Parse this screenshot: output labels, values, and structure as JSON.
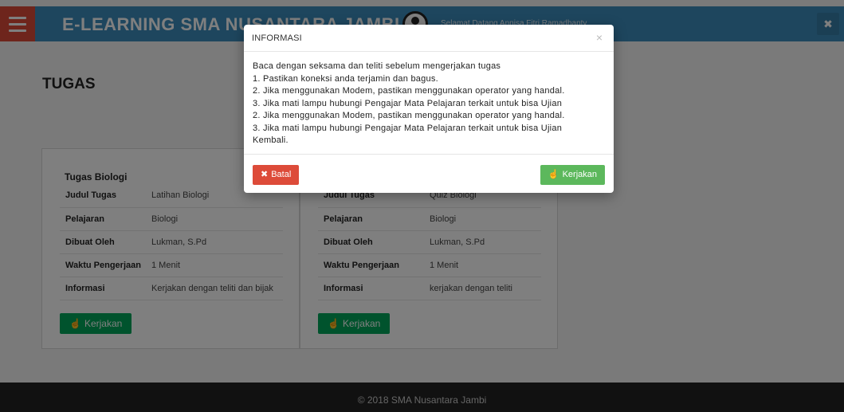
{
  "header": {
    "brand": "E-LEARNING SMA NUSANTARA JAMBI",
    "welcome": "Selamat Datang Annisa Fitri Ramadhanty",
    "corner_icon": "✖"
  },
  "page": {
    "title": "TUGAS"
  },
  "assignments": [
    {
      "heading": "Tugas Biologi",
      "rows": [
        {
          "label": "Judul Tugas",
          "value": "Latihan Biologi"
        },
        {
          "label": "Pelajaran",
          "value": "Biologi"
        },
        {
          "label": "Dibuat Oleh",
          "value": "Lukman, S.Pd"
        },
        {
          "label": "Waktu Pengerjaan",
          "value": "1 Menit"
        },
        {
          "label": "Informasi",
          "value": "Kerjakan dengan teliti dan bijak"
        }
      ],
      "button": "Kerjakan"
    },
    {
      "heading": "",
      "rows": [
        {
          "label": "Judul Tugas",
          "value": "Quiz Biologi"
        },
        {
          "label": "Pelajaran",
          "value": "Biologi"
        },
        {
          "label": "Dibuat Oleh",
          "value": "Lukman, S.Pd"
        },
        {
          "label": "Waktu Pengerjaan",
          "value": "1 Menit"
        },
        {
          "label": "Informasi",
          "value": "kerjakan dengan teliti"
        }
      ],
      "button": "Kerjakan"
    }
  ],
  "footer": {
    "text": "© 2018 SMA Nusantara Jambi"
  },
  "modal": {
    "title": "INFORMASI",
    "close": "×",
    "lines": [
      "Baca dengan seksama dan teliti sebelum mengerjakan tugas",
      "1. Pastikan koneksi anda terjamin dan bagus.",
      "2. Jika menggunakan Modem, pastikan menggunakan operator yang handal.",
      "3. Jika mati lampu hubungi Pengajar Mata Pelajaran terkait untuk bisa Ujian",
      "2. Jika menggunakan Modem, pastikan menggunakan operator yang handal.",
      "3. Jika mati lampu hubungi Pengajar Mata Pelajaran terkait untuk bisa Ujian",
      "Kembali."
    ],
    "cancel_label": "Batal",
    "cancel_icon": "✖",
    "go_label": "Kerjakan",
    "go_icon": "👍"
  },
  "colors": {
    "header": "#3c8dbc",
    "menu_button": "#dd4b39",
    "cancel": "#dd4b39",
    "success": "#5cb85c",
    "footer": "#222222"
  }
}
